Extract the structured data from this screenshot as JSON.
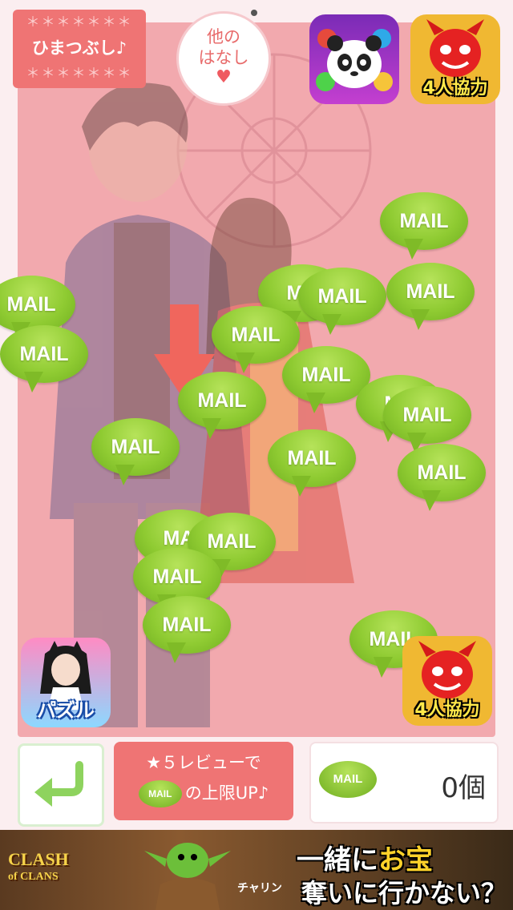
{
  "header": {
    "stars": "＊＊＊＊＊＊＊",
    "badge_title": "ひまつぶし♪",
    "other_line1": "他の",
    "other_line2": "はなし",
    "other_heart": "♥"
  },
  "ads": {
    "devil_label": "4人協力",
    "puzzle_label": "パズル",
    "panda_icon": "panda-puzzle-game-icon"
  },
  "mail_label": "MAIL",
  "mails_overlapped_label": "MA",
  "bottom": {
    "review_line1": "★５レビューで",
    "review_line2": "の上限UP♪",
    "review_mini_mail": "MAIL",
    "count_mail": "MAIL",
    "count_value": "0個"
  },
  "banner": {
    "brand_line1": "CLASH",
    "brand_line2": "of CLANS",
    "tag": "チャリン",
    "copy_part1": "一緒に",
    "copy_highlight": "お宝",
    "copy_line2": "奪いに行かない？"
  },
  "colors": {
    "accent_pink": "#ef7474",
    "mail_green": "#8fcb32",
    "scene_bg": "#f2a9ae"
  }
}
